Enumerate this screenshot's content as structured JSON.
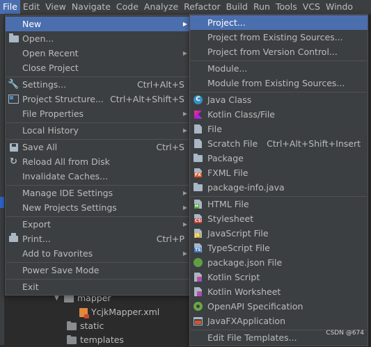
{
  "menubar": {
    "items": [
      {
        "label": "File",
        "active": true
      },
      {
        "label": "Edit"
      },
      {
        "label": "View"
      },
      {
        "label": "Navigate"
      },
      {
        "label": "Code"
      },
      {
        "label": "Analyze"
      },
      {
        "label": "Refactor"
      },
      {
        "label": "Build"
      },
      {
        "label": "Run"
      },
      {
        "label": "Tools"
      },
      {
        "label": "VCS"
      },
      {
        "label": "Windo"
      }
    ]
  },
  "file_menu": {
    "items": [
      {
        "label": "New",
        "submenu": true,
        "selected": true
      },
      {
        "label": "Open...",
        "icon": "folder-open-icon"
      },
      {
        "label": "Open Recent",
        "submenu": true
      },
      {
        "label": "Close Project"
      },
      {
        "label": "Settings...",
        "shortcut": "Ctrl+Alt+S",
        "icon": "wrench-icon"
      },
      {
        "label": "Project Structure...",
        "shortcut": "Ctrl+Alt+Shift+S",
        "icon": "project-structure-icon"
      },
      {
        "label": "File Properties",
        "submenu": true
      },
      {
        "label": "Local History",
        "submenu": true
      },
      {
        "label": "Save All",
        "shortcut": "Ctrl+S",
        "icon": "save-icon"
      },
      {
        "label": "Reload All from Disk",
        "icon": "reload-icon"
      },
      {
        "label": "Invalidate Caches..."
      },
      {
        "label": "Manage IDE Settings",
        "submenu": true
      },
      {
        "label": "New Projects Settings",
        "submenu": true
      },
      {
        "label": "Export",
        "submenu": true
      },
      {
        "label": "Print...",
        "shortcut": "Ctrl+P",
        "icon": "print-icon"
      },
      {
        "label": "Add to Favorites",
        "submenu": true
      },
      {
        "label": "Power Save Mode"
      },
      {
        "label": "Exit"
      }
    ]
  },
  "new_menu": {
    "items": [
      {
        "label": "Project...",
        "selected": true
      },
      {
        "label": "Project from Existing Sources..."
      },
      {
        "label": "Project from Version Control..."
      },
      {
        "label": "Module..."
      },
      {
        "label": "Module from Existing Sources..."
      },
      {
        "label": "Java Class",
        "icon": "java-class-icon"
      },
      {
        "label": "Kotlin Class/File",
        "icon": "kotlin-icon"
      },
      {
        "label": "File",
        "icon": "file-icon"
      },
      {
        "label": "Scratch File",
        "shortcut": "Ctrl+Alt+Shift+Insert",
        "icon": "scratch-file-icon"
      },
      {
        "label": "Package",
        "icon": "package-icon"
      },
      {
        "label": "FXML File",
        "icon": "fxml-icon"
      },
      {
        "label": "package-info.java",
        "icon": "package-info-icon"
      },
      {
        "label": "HTML File",
        "icon": "html-icon"
      },
      {
        "label": "Stylesheet",
        "icon": "css-icon"
      },
      {
        "label": "JavaScript File",
        "icon": "javascript-icon"
      },
      {
        "label": "TypeScript File",
        "icon": "typescript-icon"
      },
      {
        "label": "package.json File",
        "icon": "package-json-icon"
      },
      {
        "label": "Kotlin Script",
        "icon": "kotlin-script-icon"
      },
      {
        "label": "Kotlin Worksheet",
        "icon": "kotlin-worksheet-icon"
      },
      {
        "label": "OpenAPI Specification",
        "icon": "openapi-icon"
      },
      {
        "label": "JavaFXApplication",
        "icon": "javafx-app-icon"
      },
      {
        "label": "Edit File Templates..."
      }
    ]
  },
  "project_tree": {
    "mapper": "mapper",
    "xml_file": "YcjkMapper.xml",
    "static": "static",
    "templates": "templates"
  },
  "watermark": "CSDN @674",
  "colors": {
    "menubar_bg": "#3c3f41",
    "menu_bg": "#3c3f41",
    "selection": "#4b6eaf",
    "text": "#bbbbbb",
    "editor_bg": "#2b2b2b"
  }
}
